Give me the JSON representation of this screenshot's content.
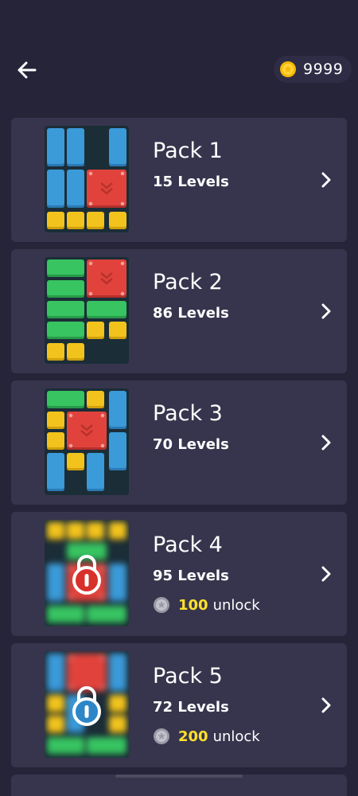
{
  "header": {
    "coins": "9999"
  },
  "packs": [
    {
      "title": "Pack 1",
      "levels": "15 Levels",
      "locked": false
    },
    {
      "title": "Pack 2",
      "levels": "86 Levels",
      "locked": false
    },
    {
      "title": "Pack 3",
      "levels": "70 Levels",
      "locked": false
    },
    {
      "title": "Pack 4",
      "levels": "95 Levels",
      "locked": true,
      "unlock_price": "100",
      "unlock_label": "unlock",
      "lock_color": "#ffffff"
    },
    {
      "title": "Pack 5",
      "levels": "72 Levels",
      "locked": true,
      "unlock_price": "200",
      "unlock_label": "unlock",
      "lock_color": "#ffffff"
    }
  ],
  "colors": {
    "background": "#262438",
    "card": "#37354d",
    "price": "#ffe12d",
    "coin": "#f5b800"
  },
  "icons": {
    "back": "back-arrow-icon",
    "coin": "gold-coin-icon",
    "chevron": "chevron-right-icon",
    "lock": "lock-icon",
    "silver_coin": "silver-coin-icon"
  }
}
